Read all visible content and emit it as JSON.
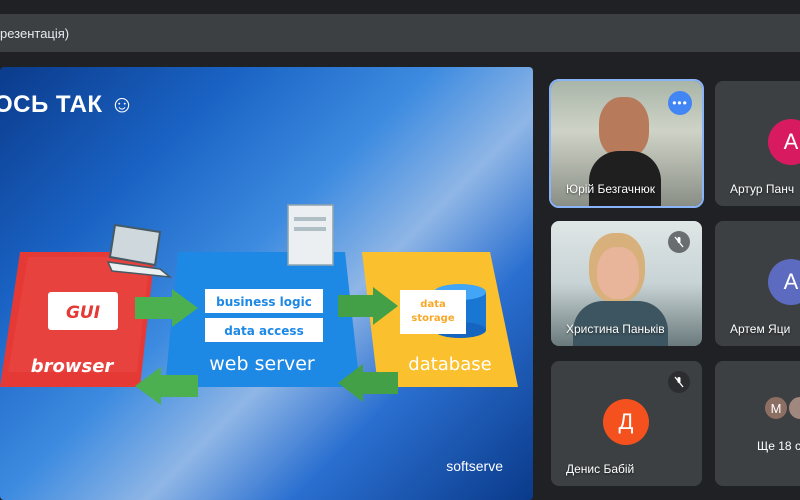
{
  "window": {
    "title": "резентація)"
  },
  "slide": {
    "title": "ось так ☺",
    "brand": "softserve",
    "diagram": {
      "browser_label": "browser",
      "gui_label": "GUI",
      "web_server_label": "web server",
      "business_logic_label": "business logic",
      "data_access_label": "data access",
      "database_label": "database",
      "data_storage_label": "data\nstorage"
    }
  },
  "participants": [
    {
      "name": "Юрій Безгачнюк",
      "type": "video",
      "more_icon": "more-horizontal-icon"
    },
    {
      "name": "Артур Панч",
      "initial": "А",
      "avatar_color": "#d81b60",
      "type": "avatar"
    },
    {
      "name": "Христина Паньків",
      "type": "video",
      "muted": true
    },
    {
      "name": "Артем Яци",
      "initial": "А",
      "avatar_color": "#5c6bc0",
      "type": "avatar"
    },
    {
      "name": "Денис Бабій",
      "initial": "Д",
      "avatar_color": "#f4511e",
      "type": "avatar",
      "muted": true
    },
    {
      "name": "Ще 18 с",
      "initial": "М",
      "avatar_color": "#8d6e63",
      "type": "overflow"
    }
  ],
  "colors": {
    "accent": "#8ab4f8",
    "tile_bg": "#3c4043",
    "page_bg": "#202124"
  }
}
